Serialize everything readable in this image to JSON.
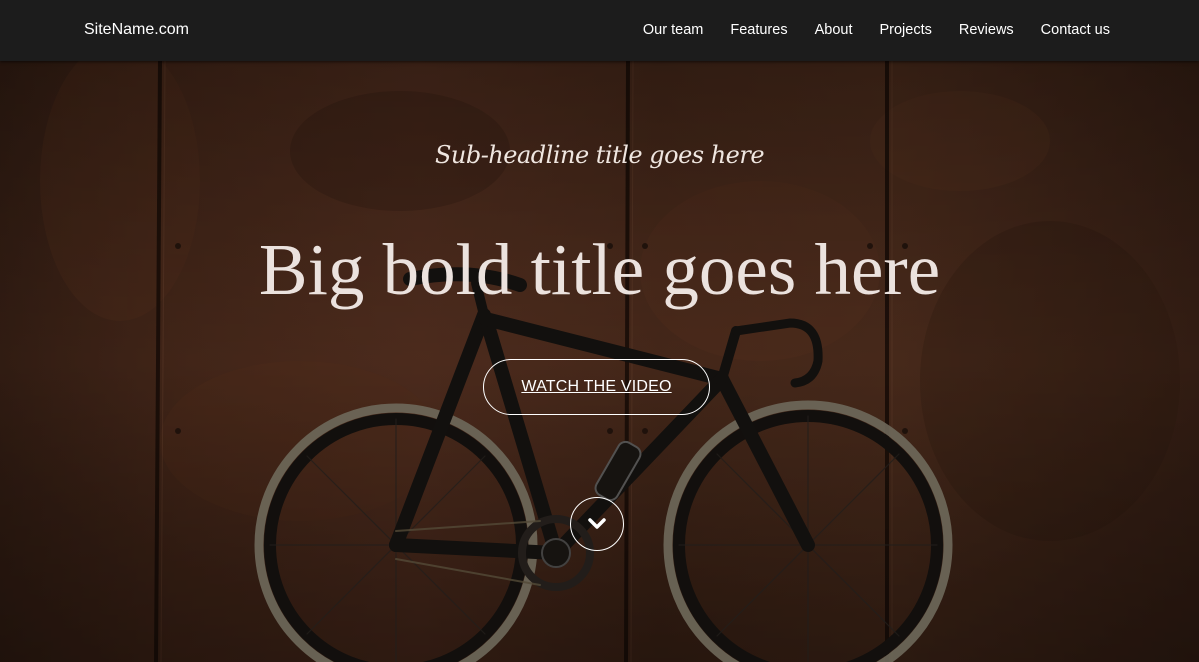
{
  "header": {
    "brand": "SiteName.com",
    "nav": [
      {
        "label": "Our team"
      },
      {
        "label": "Features"
      },
      {
        "label": "About"
      },
      {
        "label": "Projects"
      },
      {
        "label": "Reviews"
      },
      {
        "label": "Contact us"
      }
    ]
  },
  "hero": {
    "subheadline": "Sub-headline title goes here",
    "headline": "Big bold title goes here",
    "cta_label": "WATCH THE VIDEO",
    "scroll_icon": "chevron-down-icon",
    "background_image": "road-bicycle-against-rusted-steel-wall"
  },
  "colors": {
    "navbar_bg": "#1c1c1c",
    "text": "#ffffff",
    "rust_wall": "#4a2a1c"
  }
}
